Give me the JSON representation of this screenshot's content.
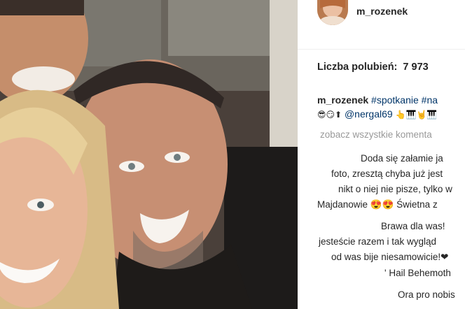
{
  "post": {
    "username": "m_rozenek",
    "likes_label": "Liczba polubień:",
    "likes_count": "7 973",
    "caption_user": "m_rozenek",
    "caption_tags": "#spotkanie #na",
    "line2_prefix": "😎😏⬆",
    "line2_mention": "@nergal69",
    "line2_suffix": "👆🎹🤘🎹",
    "view_all": "zobacz wszystkie komenta"
  },
  "comments": [
    "Doda się załamie ja",
    "foto, zresztą chyba już jest",
    "nikt o niej nie pisze, tylko w",
    "Majdanowie 😍😍 Świetna z",
    "Brawa dla was!",
    "jesteście razem i tak wygląd",
    "od was bije niesamowicie!❤",
    "' Hail Behemoth",
    "Ora pro nobis"
  ],
  "icons": {
    "avatar": "profile-avatar",
    "photo": "post-photo"
  },
  "colors": {
    "link": "#003569",
    "muted": "#999999",
    "text": "#262626"
  }
}
